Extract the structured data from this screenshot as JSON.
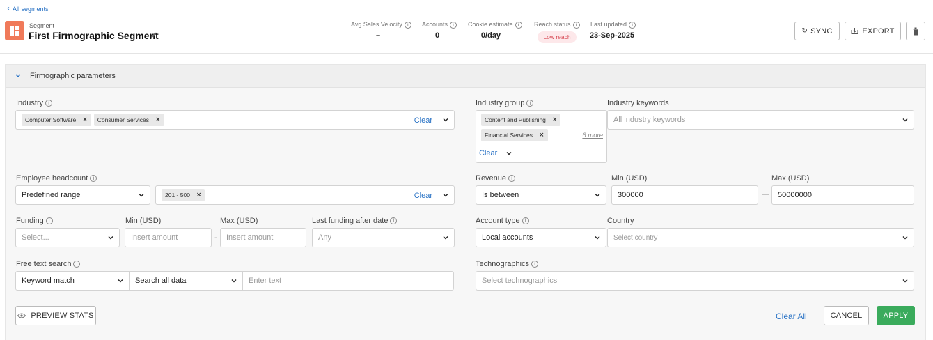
{
  "header": {
    "back_link": "All segments",
    "segment_caption": "Segment",
    "segment_name": "First Firmographic Segment",
    "stats": [
      {
        "label": "Avg Sales Velocity",
        "value": "–"
      },
      {
        "label": "Accounts",
        "value": "0"
      },
      {
        "label": "Cookie estimate",
        "value": "0/day"
      },
      {
        "label": "Reach status",
        "value": "Low reach"
      },
      {
        "label": "Last updated",
        "value": "23-Sep-2025"
      }
    ],
    "sync_label": "SYNC",
    "export_label": "EXPORT"
  },
  "panel": {
    "title": "Firmographic parameters"
  },
  "industry": {
    "label": "Industry",
    "chips": [
      "Computer Software",
      "Consumer Services"
    ],
    "clear": "Clear"
  },
  "industry_group": {
    "label": "Industry group",
    "chips": [
      "Content and Publishing",
      "Financial Services"
    ],
    "more": "6 more",
    "clear": "Clear"
  },
  "industry_keywords": {
    "label": "Industry keywords",
    "placeholder": "All industry keywords"
  },
  "headcount": {
    "label": "Employee headcount",
    "mode": "Predefined range",
    "chips": [
      "201 - 500"
    ],
    "clear": "Clear"
  },
  "revenue": {
    "label": "Revenue",
    "mode": "Is between",
    "min_label": "Min (USD)",
    "max_label": "Max (USD)",
    "min_value": "300000",
    "max_value": "50000000",
    "dash": "—"
  },
  "funding": {
    "label": "Funding",
    "select_placeholder": "Select...",
    "min_label": "Min (USD)",
    "max_label": "Max (USD)",
    "min_placeholder": "Insert amount",
    "max_placeholder": "Insert amount",
    "dash": "-",
    "last_funding_label": "Last funding after date",
    "last_funding_value": "Any"
  },
  "account_type": {
    "label": "Account type",
    "value": "Local accounts"
  },
  "country": {
    "label": "Country",
    "placeholder": "Select country"
  },
  "free_text": {
    "label": "Free text search",
    "match": "Keyword match",
    "scope": "Search all data",
    "placeholder": "Enter text"
  },
  "technographics": {
    "label": "Technographics",
    "placeholder": "Select technographics"
  },
  "footer": {
    "preview": "PREVIEW STATS",
    "clear_all": "Clear All",
    "cancel": "CANCEL",
    "apply": "APPLY"
  },
  "colors": {
    "accent": "#2a73c5",
    "apply_green": "#3aab5c",
    "segment_icon": "#f07a5a",
    "reach_badge_bg": "#fde8ea",
    "reach_badge_text": "#d64550"
  }
}
